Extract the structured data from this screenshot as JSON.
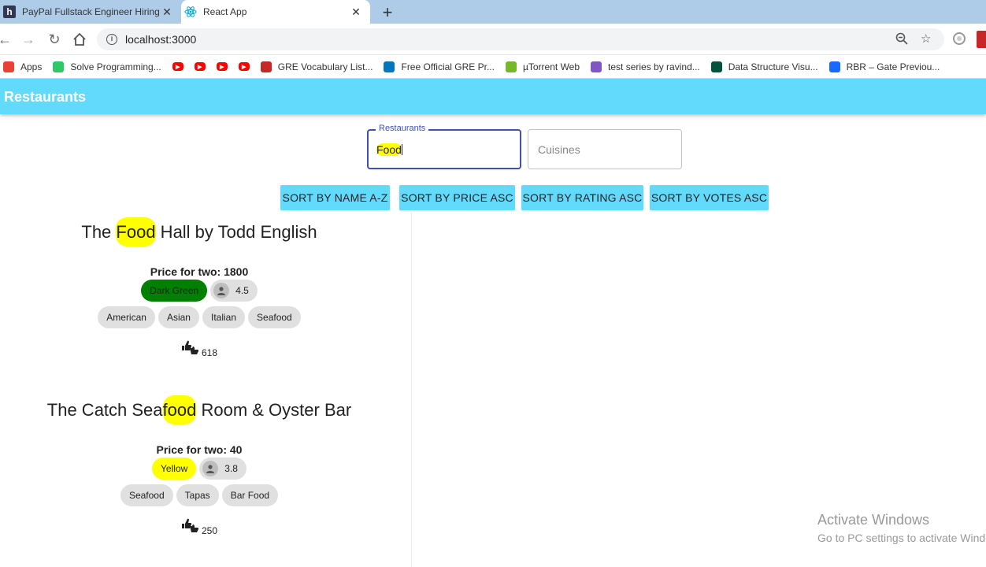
{
  "browser": {
    "tabs": [
      {
        "title": "PayPal Fullstack Engineer Hiring C",
        "favicon": "hackerearth-icon",
        "active": false
      },
      {
        "title": "React App",
        "favicon": "react-icon",
        "active": true
      }
    ],
    "url": "localhost:3000",
    "bookmarks": [
      {
        "label": "Apps",
        "icon": "apps-grid-icon",
        "color": "#e94235"
      },
      {
        "label": "Solve Programming...",
        "icon": "hackerrank-icon",
        "color": "#2ec866"
      },
      {
        "label": "",
        "icon": "youtube-icon",
        "color": "#ff0000"
      },
      {
        "label": "",
        "icon": "youtube-icon",
        "color": "#ff0000"
      },
      {
        "label": "",
        "icon": "youtube-icon",
        "color": "#ff0000"
      },
      {
        "label": "",
        "icon": "youtube-icon",
        "color": "#ff0000"
      },
      {
        "label": "GRE Vocabulary List...",
        "icon": "gre-icon",
        "color": "#c62828"
      },
      {
        "label": "Free Official GRE Pr...",
        "icon": "ets-icon",
        "color": "#0277bd"
      },
      {
        "label": "µTorrent Web",
        "icon": "utorrent-icon",
        "color": "#76b82a"
      },
      {
        "label": "test series by ravind...",
        "icon": "test-series-icon",
        "color": "#7e57c2"
      },
      {
        "label": "Data Structure Visu...",
        "icon": "usf-icon",
        "color": "#00543c"
      },
      {
        "label": "RBR – Gate Previou...",
        "icon": "behance-icon",
        "color": "#1769ff"
      }
    ]
  },
  "app": {
    "title": "Restaurants",
    "search": {
      "restaurants_label": "Restaurants",
      "restaurants_value": "Food",
      "cuisines_placeholder": "Cuisines"
    },
    "sort_buttons": [
      "SORT BY NAME A-Z",
      "SORT BY PRICE ASC",
      "SORT BY RATING ASC",
      "SORT BY VOTES ASC"
    ],
    "restaurants": [
      {
        "name_before": "The ",
        "name_match": "Food",
        "name_after": " Hall by Todd English",
        "price_label": "Price for two: 1800",
        "rating_color_text": "Dark Green",
        "rating_color": "#008000",
        "rating": "4.5",
        "cuisines": [
          "American",
          "Asian",
          "Italian",
          "Seafood"
        ],
        "votes": "618"
      },
      {
        "name_before": "The Catch Sea",
        "name_match": "food",
        "name_after": " Room & Oyster Bar",
        "price_label": "Price for two: 40",
        "rating_color_text": "Yellow",
        "rating_color": "#ffff00",
        "rating": "3.8",
        "cuisines": [
          "Seafood",
          "Tapas",
          "Bar Food"
        ],
        "votes": "250"
      }
    ]
  },
  "os": {
    "watermark_title": "Activate Windows",
    "watermark_subtitle": "Go to PC settings to activate Windows."
  }
}
